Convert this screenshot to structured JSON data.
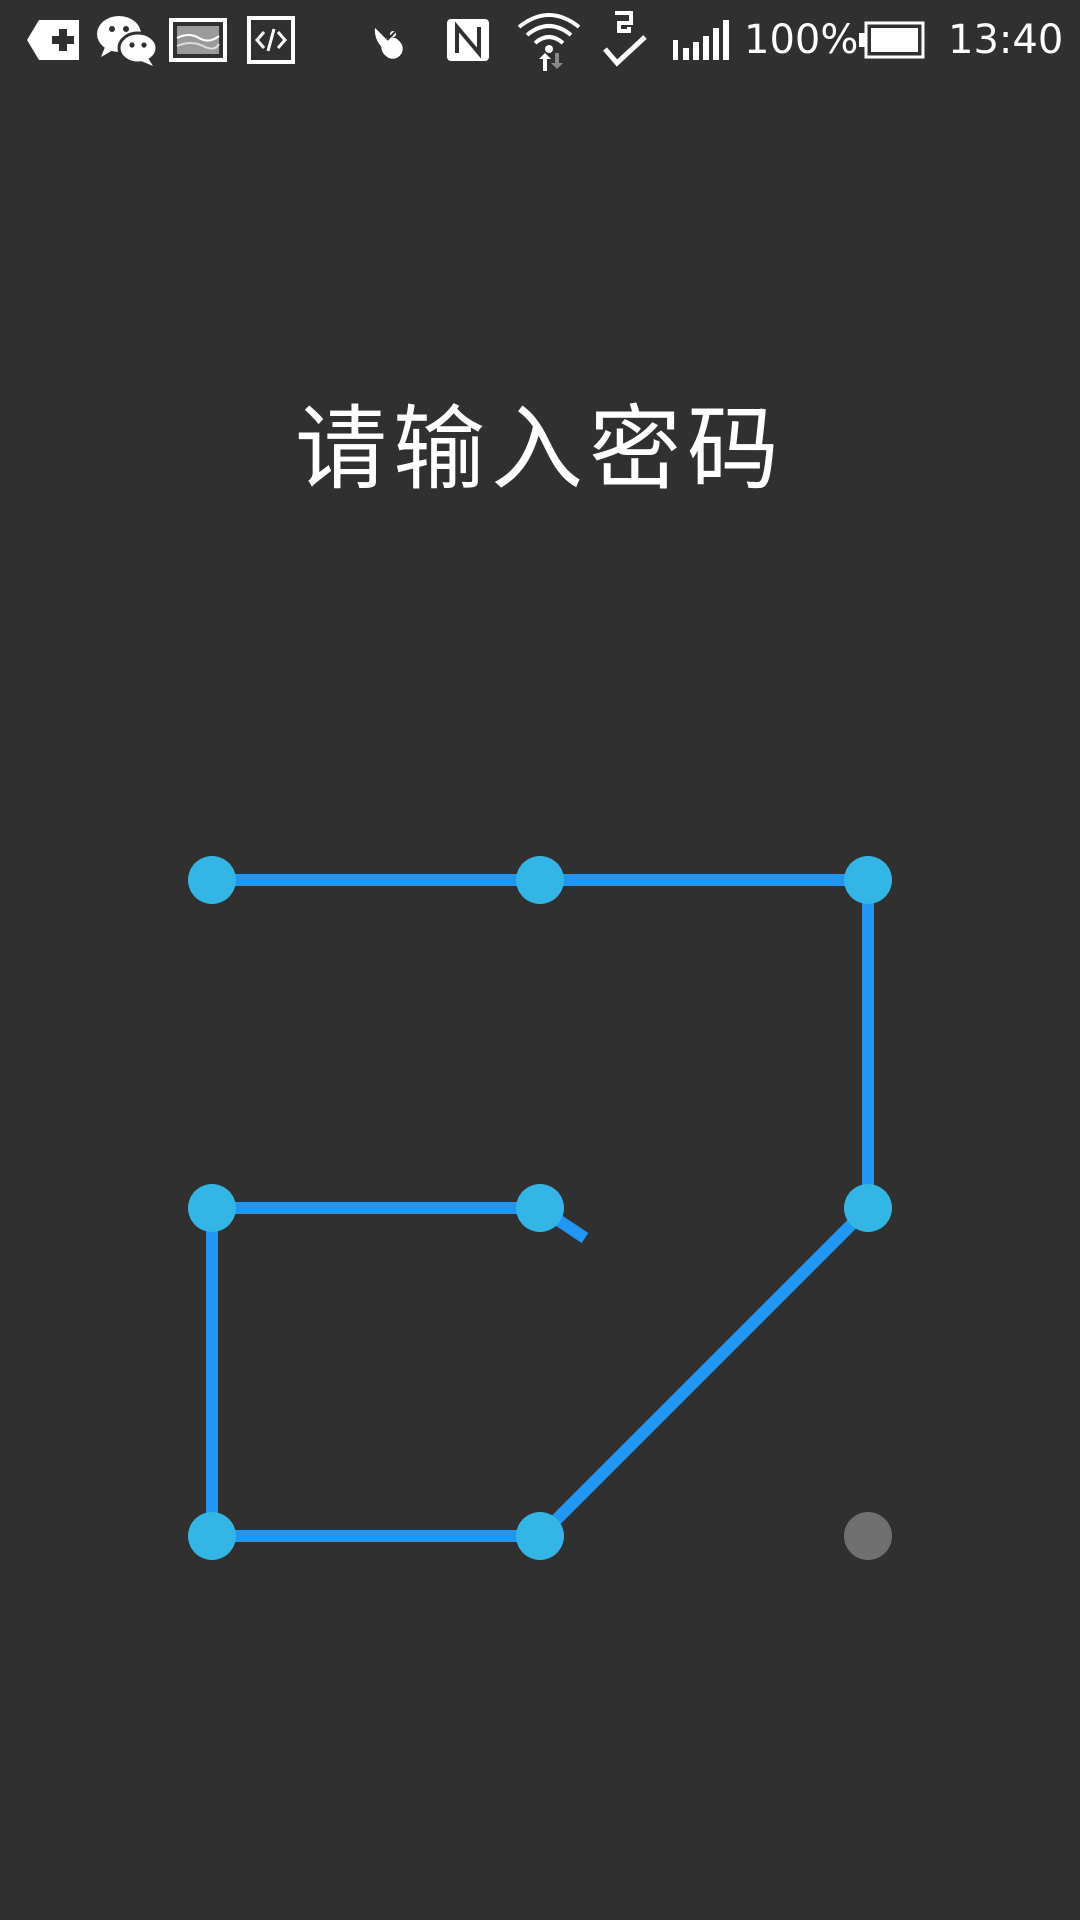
{
  "status_bar": {
    "notification_icons": [
      "app-add-icon",
      "wechat-icon",
      "image-icon",
      "code-icon"
    ],
    "system_icons": [
      "satellite-dish-icon",
      "nfc-icon",
      "wifi-icon",
      "sync-check-icon",
      "signal-icon",
      "battery-icon"
    ],
    "battery_percent": "100%",
    "battery_level": 1.0,
    "time": "13:40"
  },
  "lock_screen": {
    "title": "请输入密码"
  },
  "pattern": {
    "grid": 3,
    "selected_nodes": [
      1,
      2,
      3,
      6,
      8,
      7,
      4,
      5
    ],
    "unselected_nodes": [
      9
    ],
    "trailing_direction": "down-right",
    "colors": {
      "line": "#2196F3",
      "node_active": "#33B5E5",
      "node_inactive": "#707070",
      "background": "#303030"
    }
  }
}
